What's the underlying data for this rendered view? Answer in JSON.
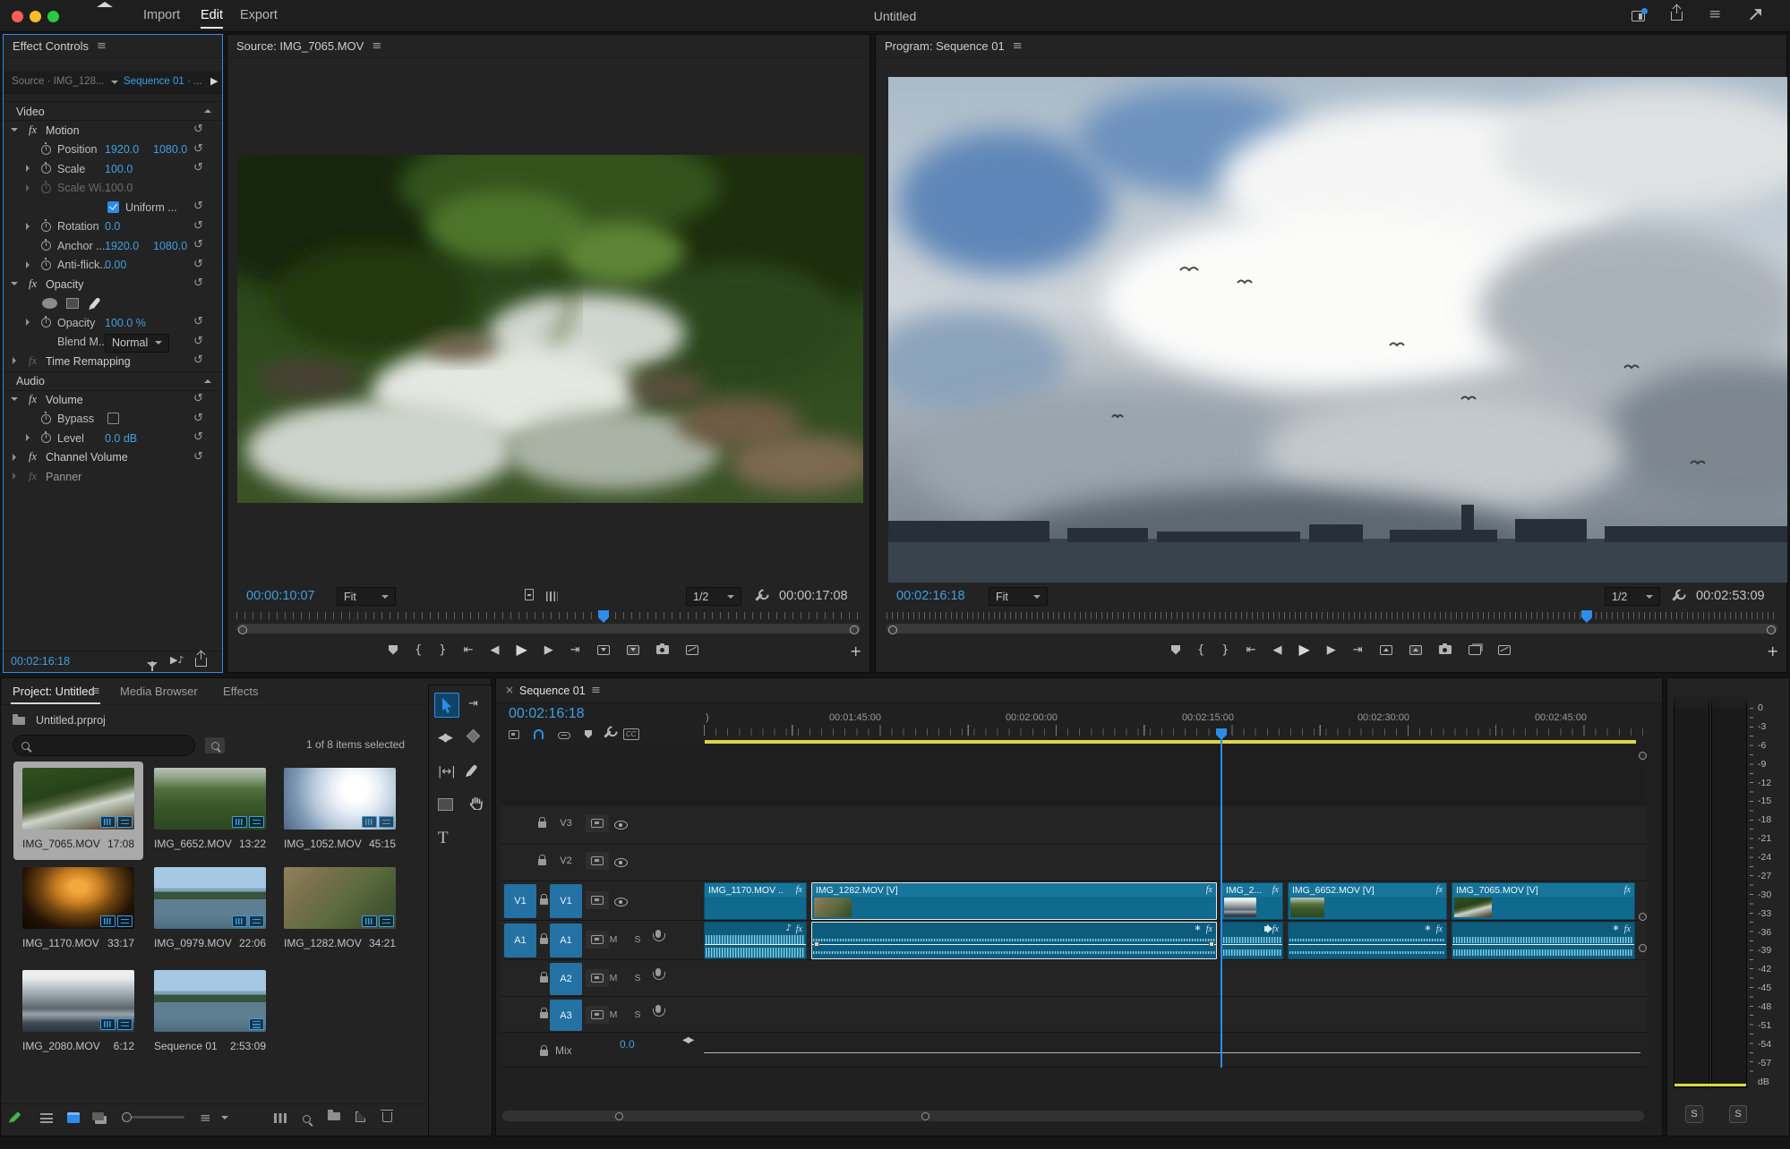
{
  "ui_colors": {
    "accent": "#2D8CEB",
    "timecode_blue": "#3F9FE0",
    "clip_teal": "#0F6A8E",
    "waveform_blue": "#86D8F3",
    "work_area_yellow": "#DED24E",
    "selection_gray": "#A9A9A9",
    "traffic_red": "#FF5F57",
    "traffic_yellow": "#FEBC2E",
    "traffic_green": "#28C840",
    "writable_green": "#49B04C"
  },
  "icons": {
    "menu": "≡",
    "play": "▶",
    "step_back": "◀",
    "step_fwd": "▶",
    "goto_in": "⇤",
    "goto_out": "⇥",
    "mark_in": "{",
    "mark_out": "}",
    "plus": "+",
    "note": "♪",
    "star": "∗",
    "close": "×",
    "reset": "↺",
    "cc": "CC",
    "play_note": "▶♪"
  },
  "app": {
    "title": "Untitled",
    "nav_import": "Import",
    "nav_edit": "Edit",
    "nav_export": "Export"
  },
  "effect_controls": {
    "title": "Effect Controls",
    "source_tab": "Source · IMG_128...",
    "sequence_tab": "Sequence 01 · ...",
    "video_section": "Video",
    "audio_section": "Audio",
    "motion": "Motion",
    "position": {
      "label": "Position",
      "x": "1920.0",
      "y": "1080.0"
    },
    "scale": {
      "label": "Scale",
      "value": "100.0"
    },
    "scale_width": {
      "label": "Scale Wi...",
      "value": "100.0"
    },
    "uniform": "Uniform ...",
    "rotation": {
      "label": "Rotation",
      "value": "0.0"
    },
    "anchor": {
      "label": "Anchor ...",
      "x": "1920.0",
      "y": "1080.0"
    },
    "anti_flicker": {
      "label": "Anti-flick...",
      "value": "0.00"
    },
    "opacity_group": "Opacity",
    "opacity": {
      "label": "Opacity",
      "value": "100.0 %"
    },
    "blend": {
      "label": "Blend M...",
      "value": "Normal"
    },
    "time_remapping": "Time Remapping",
    "volume": "Volume",
    "bypass": "Bypass",
    "level": {
      "label": "Level",
      "value": "0.0 dB"
    },
    "channel_volume": "Channel Volume",
    "panner": "Panner",
    "timecode": "00:02:16:18"
  },
  "source_monitor": {
    "title": "Source: IMG_7065.MOV",
    "timecode": "00:00:10:07",
    "zoom": "Fit",
    "quality": "1/2",
    "duration": "00:00:17:08"
  },
  "program_monitor": {
    "title": "Program: Sequence 01",
    "timecode": "00:02:16:18",
    "zoom": "Fit",
    "quality": "1/2",
    "duration": "00:02:53:09"
  },
  "project": {
    "tab": "Project: Untitled",
    "tab_media": "Media Browser",
    "tab_effects": "Effects",
    "file": "Untitled.prproj",
    "selection": "1 of 8 items selected",
    "items": [
      {
        "name": "IMG_7065.MOV",
        "duration": "17:08"
      },
      {
        "name": "IMG_6652.MOV",
        "duration": "13:22"
      },
      {
        "name": "IMG_1052.MOV",
        "duration": "45:15"
      },
      {
        "name": "IMG_1170.MOV",
        "duration": "33:17"
      },
      {
        "name": "IMG_0979.MOV",
        "duration": "22:06"
      },
      {
        "name": "IMG_1282.MOV",
        "duration": "34:21"
      },
      {
        "name": "IMG_2080.MOV",
        "duration": "6:12"
      },
      {
        "name": "Sequence 01",
        "duration": "2:53:09"
      }
    ]
  },
  "timeline": {
    "tab": "Sequence 01",
    "timecode": "00:02:16:18",
    "ruler": [
      ")",
      "00:01:45:00",
      "00:02:00:00",
      "00:02:15:00",
      "00:02:30:00",
      "00:02:45:00"
    ],
    "v_tracks": [
      "V3",
      "V2",
      "V1"
    ],
    "a_tracks": [
      "A1",
      "A2",
      "A3"
    ],
    "mute": "M",
    "solo": "S",
    "mix_label": "Mix",
    "mix_value": "0.0",
    "clips": [
      {
        "name": "IMG_1170.MOV .."
      },
      {
        "name": "IMG_1282.MOV [V]"
      },
      {
        "name": "IMG_2..."
      },
      {
        "name": "IMG_6652.MOV [V]"
      },
      {
        "name": "IMG_7065.MOV [V]"
      }
    ]
  },
  "meters": {
    "labels": [
      "0",
      "-3",
      "-6",
      "-9",
      "-12",
      "-15",
      "-18",
      "-21",
      "-24",
      "-27",
      "-30",
      "-33",
      "-36",
      "-39",
      "-42",
      "-45",
      "-48",
      "-51",
      "-54",
      "-57",
      "dB"
    ],
    "solo": "S"
  }
}
